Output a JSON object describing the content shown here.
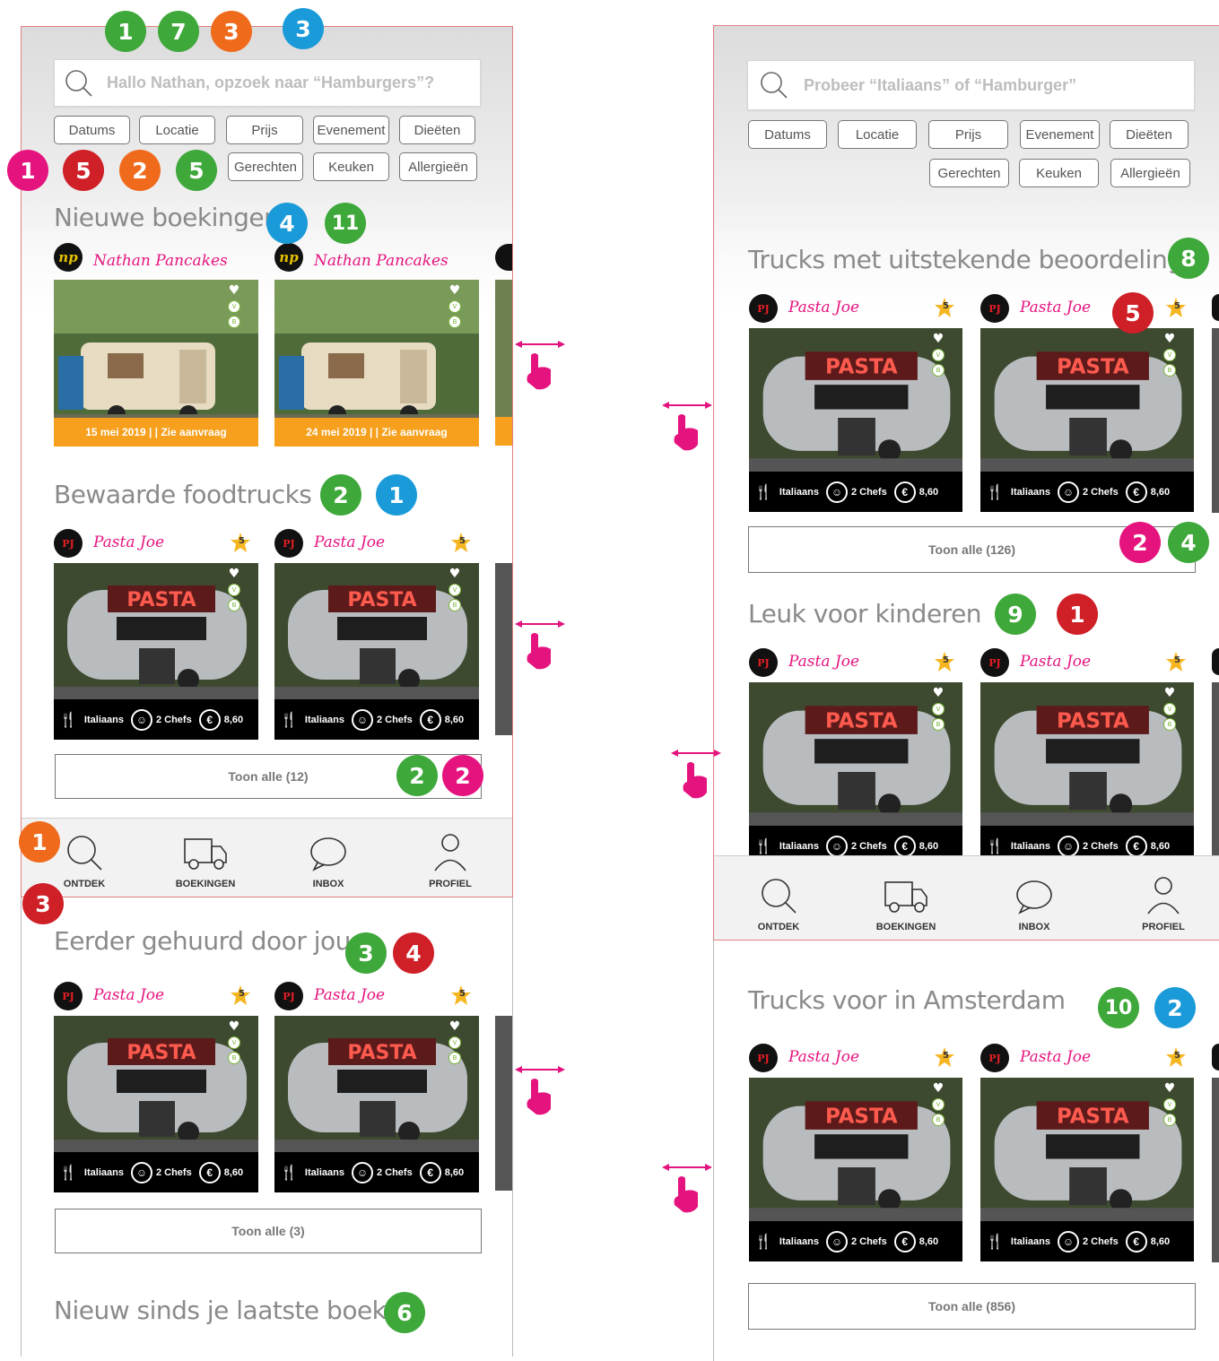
{
  "left": {
    "search_placeholder": "Hallo Nathan, opzoek naar “Hamburgers”?",
    "filters_row1": [
      "Datums",
      "Locatie",
      "Prijs",
      "Evenement",
      "Dieëten"
    ],
    "filters_row2": [
      "Gerechten",
      "Keuken",
      "Allergieën"
    ],
    "section_new_bookings": "Nieuwe boekingen",
    "booking_vendor": "Nathan Pancakes",
    "booking_dates": [
      "15 mei 2019 | | Zie aanvraag",
      "24 mei 2019 | | Zie aanvraag"
    ],
    "section_saved": "Bewaarde foodtrucks",
    "toon_saved": "Toon alle (12)",
    "section_rented": "Eerder gehuurd door jou",
    "toon_rented": "Toon alle (3)",
    "section_new_since": "Nieuw sinds je laatste boeking"
  },
  "right": {
    "search_placeholder": "Probeer “Italiaans”  of “Hamburger”",
    "section_top_rated": "Trucks met uitstekende beoordeling",
    "toon_top_rated": "Toon alle (126)",
    "section_kids": "Leuk voor kinderen",
    "section_amsterdam": "Trucks voor in Amsterdam",
    "toon_amsterdam": "Toon alle (856)"
  },
  "truck": {
    "vendor": "Pasta Joe",
    "logo_text": "PJ",
    "rating": "5",
    "cuisine": "Italiaans",
    "chefs": "2 Chefs",
    "price": "8,60",
    "euro": "€"
  },
  "booking_logo_text": "np",
  "nav": [
    "ONTDEK",
    "BOEKINGEN",
    "INBOX",
    "PROFIEL"
  ],
  "badges": {
    "left_top": [
      "1",
      "7",
      "3",
      "3"
    ],
    "left_filters": [
      "1",
      "5",
      "2",
      "5"
    ],
    "new_bookings": [
      "4",
      "11"
    ],
    "saved": [
      "2",
      "1"
    ],
    "saved_toon": [
      "2",
      "2"
    ],
    "nav": [
      "1",
      "3"
    ],
    "rented": [
      "3",
      "4"
    ],
    "new_since": [
      "6"
    ],
    "top_rated": [
      "8"
    ],
    "top_rated_card": [
      "5"
    ],
    "top_rated_toon": [
      "2",
      "4"
    ],
    "kids": [
      "9",
      "1"
    ],
    "amsterdam": [
      "10",
      "2"
    ]
  },
  "colors": {
    "green": "#3ea83a",
    "orange": "#f06a1c",
    "blue": "#1a9ad8",
    "red": "#cf1f27",
    "pink": "#e5137e",
    "date_bar": "#f6a01d"
  }
}
